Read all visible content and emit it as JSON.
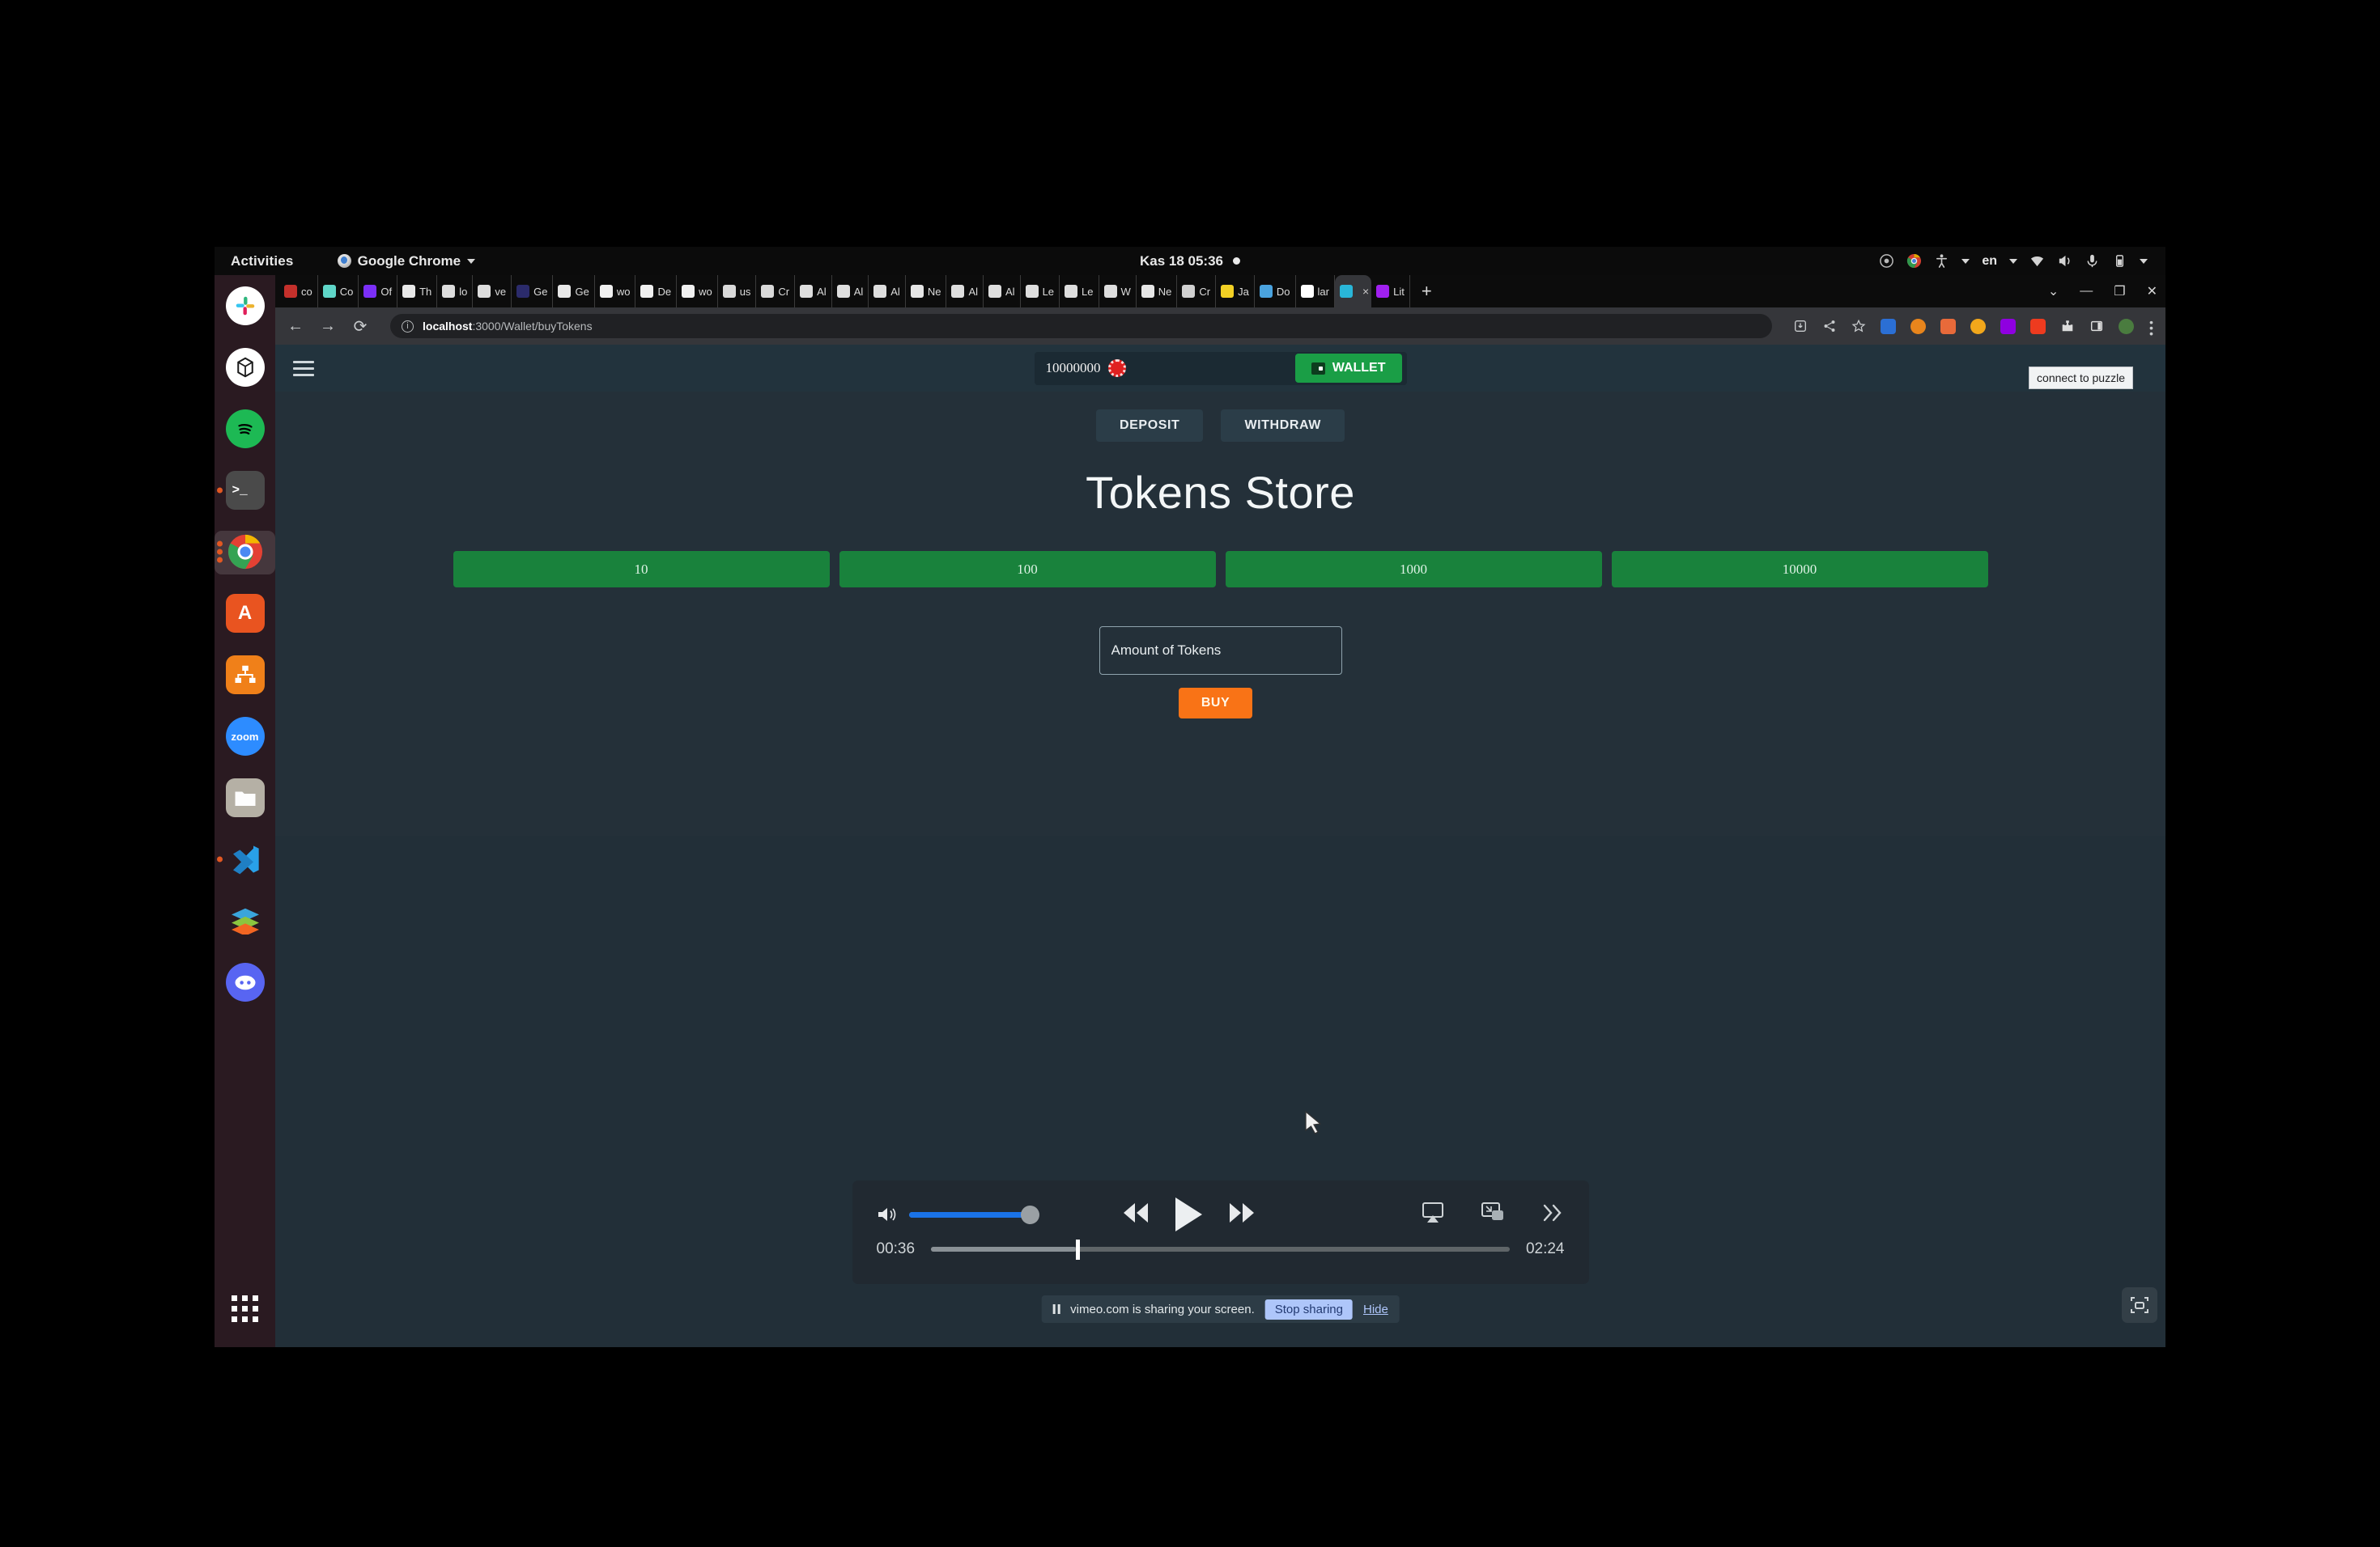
{
  "desktop": {
    "activities": "Activities",
    "app_menu": "Google Chrome",
    "clock": "Kas 18  05:36",
    "tray_icons": [
      "accessibility-icon",
      "keyboard-layout",
      "wifi-icon",
      "volume-icon",
      "microphone-icon",
      "battery-icon"
    ],
    "keyboard_layout": "en",
    "dock": [
      {
        "name": "slack",
        "label": "Slack",
        "running": false
      },
      {
        "name": "chatgpt",
        "label": "ChatGPT",
        "running": false
      },
      {
        "name": "spotify",
        "label": "Spotify",
        "running": false
      },
      {
        "name": "terminal",
        "label": "Terminal",
        "running": true
      },
      {
        "name": "google-chrome",
        "label": "Google Chrome",
        "running": true,
        "active": true
      },
      {
        "name": "ubuntu-software",
        "label": "Ubuntu Software",
        "running": false
      },
      {
        "name": "diagram-app",
        "label": "Diagrams",
        "running": false
      },
      {
        "name": "zoom",
        "label": "zoom",
        "running": false
      },
      {
        "name": "files",
        "label": "Files",
        "running": false
      },
      {
        "name": "vscode",
        "label": "Visual Studio Code",
        "running": true
      },
      {
        "name": "layers-app",
        "label": "Layers",
        "running": false
      },
      {
        "name": "discord",
        "label": "Discord",
        "running": false
      }
    ],
    "show_apps": "show-applications"
  },
  "browser": {
    "tabs": [
      {
        "label": "co",
        "favicon": "#c4302b",
        "active": false
      },
      {
        "label": "Co",
        "favicon": "#5fd6c8",
        "active": false
      },
      {
        "label": "Of",
        "favicon": "#7b2ff7",
        "active": false
      },
      {
        "label": "Th",
        "favicon": "#e8e8e8",
        "active": false
      },
      {
        "label": "lo",
        "favicon": "#dddddd",
        "active": false
      },
      {
        "label": "ve",
        "favicon": "#dddddd",
        "active": false
      },
      {
        "label": "Ge",
        "favicon": "#2b2b6b",
        "active": false
      },
      {
        "label": "Ge",
        "favicon": "#e8e8e8",
        "active": false
      },
      {
        "label": "wo",
        "favicon": "#f0f0f0",
        "active": false
      },
      {
        "label": "De",
        "favicon": "#f0f0f0",
        "active": false
      },
      {
        "label": "wo",
        "favicon": "#f0f0f0",
        "active": false
      },
      {
        "label": "us",
        "favicon": "#d9d9d9",
        "active": false
      },
      {
        "label": "Cr",
        "favicon": "#d9d9d9",
        "active": false
      },
      {
        "label": "Al",
        "favicon": "#dedede",
        "active": false
      },
      {
        "label": "Al",
        "favicon": "#dedede",
        "active": false
      },
      {
        "label": "Al",
        "favicon": "#dedede",
        "active": false
      },
      {
        "label": "Ne",
        "favicon": "#e6e6e6",
        "active": false
      },
      {
        "label": "Al",
        "favicon": "#dedede",
        "active": false
      },
      {
        "label": "Al",
        "favicon": "#dedede",
        "active": false
      },
      {
        "label": "Le",
        "favicon": "#dedede",
        "active": false
      },
      {
        "label": "Le",
        "favicon": "#dedede",
        "active": false
      },
      {
        "label": "W",
        "favicon": "#dedede",
        "active": false
      },
      {
        "label": "Ne",
        "favicon": "#e6e6e6",
        "active": false
      },
      {
        "label": "Cr",
        "favicon": "#d0d0d0",
        "active": false
      },
      {
        "label": "Ja",
        "favicon": "#f2d024",
        "active": false
      },
      {
        "label": "Do",
        "favicon": "#4aa3df",
        "active": false
      },
      {
        "label": "lar",
        "favicon": "#ffffff",
        "active": false
      },
      {
        "label": "",
        "favicon": "#29b6d8",
        "active": true
      },
      {
        "label": "Lit",
        "favicon": "#a020f0",
        "active": false
      }
    ],
    "new_tab": "+",
    "tab_search": "chevron-down-icon",
    "window_controls": [
      "minimize",
      "maximize",
      "close"
    ],
    "back": "back-icon",
    "forward": "forward-icon",
    "reload": "reload-icon",
    "url_host": "localhost",
    "url_path": ":3000/Wallet/buyTokens",
    "toolbar_icons": [
      "install-icon",
      "share-icon",
      "bookmark-star-icon"
    ],
    "extensions": [
      "extension-blue",
      "extension-fox",
      "extension-orange-a",
      "extension-bell",
      "extension-purple",
      "extension-red-pin",
      "puzzle-icon",
      "sidepanel-icon",
      "profile-avatar",
      "chrome-menu-icon"
    ]
  },
  "app": {
    "menu_button": "hamburger-menu",
    "balance": "10000000",
    "balance_icon": "poker-chip-icon",
    "wallet_button": "WALLET",
    "tooltip": "connect to puzzle",
    "tabs": [
      {
        "label": "DEPOSIT",
        "name": "deposit-tab"
      },
      {
        "label": "WITHDRAW",
        "name": "withdraw-tab"
      }
    ],
    "title": "Tokens Store",
    "quantity_buttons": [
      "10",
      "100",
      "1000",
      "10000"
    ],
    "amount_placeholder": "Amount of Tokens",
    "amount_value": "",
    "buy_button": "BUY",
    "colors": {
      "green": "#19823c",
      "wallet_green": "#1a9e46",
      "orange": "#f97316",
      "page_bg": "#243039",
      "header_bg": "#22333d"
    }
  },
  "video": {
    "volume_icon": "volume-high-icon",
    "volume_level": 90,
    "rewind": "rewind-icon",
    "play": "play-icon",
    "forward": "fast-forward-icon",
    "airplay": "airplay-icon",
    "pip": "picture-in-picture-icon",
    "more": "chevrons-right-icon",
    "current_time": "00:36",
    "duration": "02:24",
    "progress_percent": 25
  },
  "share_bar": {
    "pause_icon": "pause-icon",
    "message": "vimeo.com is sharing your screen.",
    "stop_button": "Stop sharing",
    "hide_link": "Hide"
  }
}
